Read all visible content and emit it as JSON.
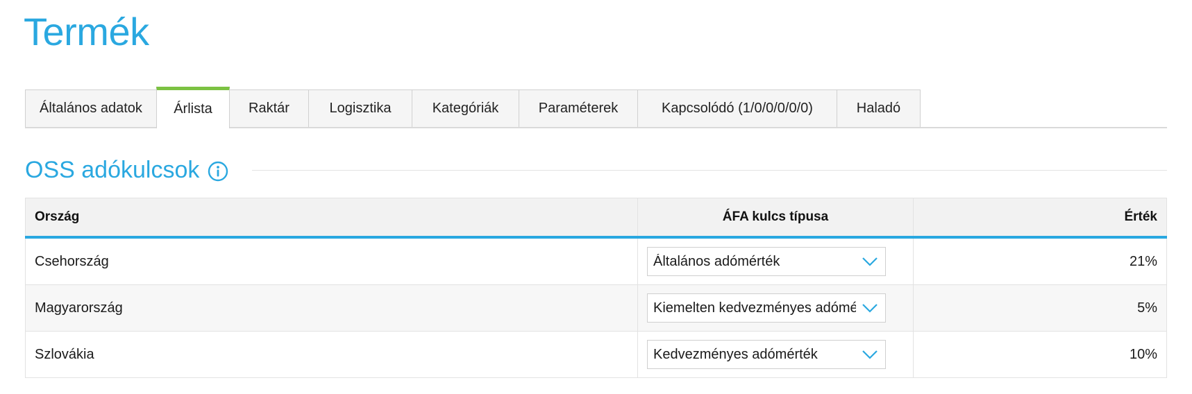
{
  "page": {
    "title": "Termék"
  },
  "tabs": [
    {
      "label": "Általános adatok",
      "active": false
    },
    {
      "label": "Árlista",
      "active": true
    },
    {
      "label": "Raktár",
      "active": false
    },
    {
      "label": "Logisztika",
      "active": false
    },
    {
      "label": "Kategóriák",
      "active": false
    },
    {
      "label": "Paraméterek",
      "active": false
    },
    {
      "label": "Kapcsolódó (1/0/0/0/0/0)",
      "active": false
    },
    {
      "label": "Haladó",
      "active": false
    }
  ],
  "section": {
    "title": "OSS adókulcsok",
    "icon": "info-circle-icon"
  },
  "table": {
    "headers": {
      "country": "Ország",
      "vat_type": "ÁFA kulcs típusa",
      "value": "Érték"
    },
    "rows": [
      {
        "country": "Csehország",
        "vat_type": "Általános adómérték",
        "value": "21%"
      },
      {
        "country": "Magyarország",
        "vat_type": "Kiemelten kedvezményes adómé",
        "value": "5%"
      },
      {
        "country": "Szlovákia",
        "vat_type": "Kedvezményes adómérték",
        "value": "10%"
      }
    ]
  },
  "colors": {
    "accent": "#2aa8e0",
    "active_tab": "#7cc242",
    "header_bg": "#f2f2f2",
    "row_alt_bg": "#f7f7f7"
  }
}
